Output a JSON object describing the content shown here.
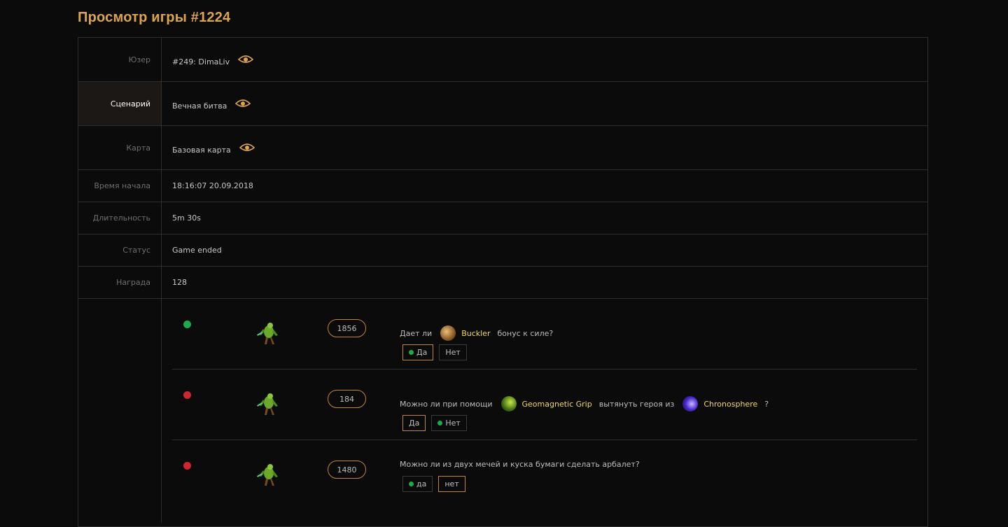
{
  "page_title": "Просмотр игры #1224",
  "rows": [
    {
      "label": "Юзер",
      "value": "#249: DimaLiv",
      "has_eye": true,
      "active": false
    },
    {
      "label": "Сценарий",
      "value": "Вечная битва",
      "has_eye": true,
      "active": true
    },
    {
      "label": "Карта",
      "value": "Базовая карта",
      "has_eye": true,
      "active": false
    },
    {
      "label": "Время начала",
      "value": "18:16:07 20.09.2018"
    },
    {
      "label": "Длительность",
      "value": "5m 30s"
    },
    {
      "label": "Статус",
      "value": "Game ended"
    },
    {
      "label": "Награда",
      "value": "128"
    }
  ],
  "answers": [
    {
      "status": "correct",
      "score": "1856",
      "question_parts": [
        "Дает ли",
        "Buckler",
        "бонус к силе?"
      ],
      "options": [
        {
          "label": "Да",
          "selected": true,
          "dot": true
        },
        {
          "label": "Нет",
          "selected": false,
          "dot": false
        }
      ]
    },
    {
      "status": "wrong",
      "score": "184",
      "question_parts": [
        "Можно ли при помощи",
        "Geomagnetic Grip",
        "вытянуть героя из",
        "Chronosphere",
        "?"
      ],
      "options": [
        {
          "label": "Да",
          "selected": true,
          "dot": false
        },
        {
          "label": "Нет",
          "selected": false,
          "dot": true
        }
      ]
    },
    {
      "status": "wrong",
      "score": "1480",
      "question_parts": [
        "Можно ли из двух мечей и куска бумаги сделать арбалет?"
      ],
      "options": [
        {
          "label": "да",
          "selected": false,
          "dot": true
        },
        {
          "label": "нет",
          "selected": true,
          "dot": false
        }
      ]
    }
  ],
  "colors": {
    "accent": "#dca44e",
    "correct": "#1faa4a",
    "wrong": "#d0262e",
    "item_name": "#f2da5a"
  }
}
